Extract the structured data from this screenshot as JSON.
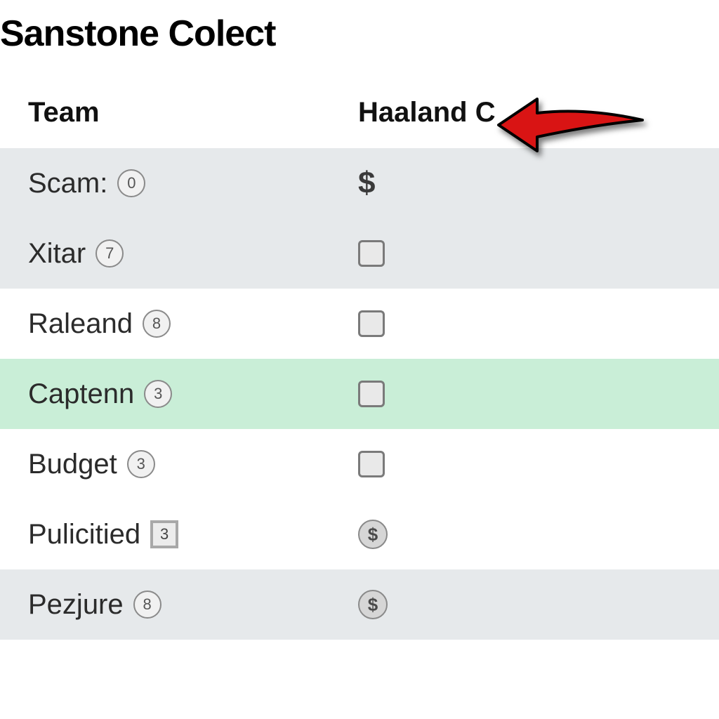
{
  "title": "Sanstone Colect",
  "columns": {
    "team": "Team",
    "haaland": "Haaland C"
  },
  "rows": [
    {
      "label": "Scam",
      "colon": true,
      "badge": "0",
      "badgeShape": "circle",
      "value": {
        "kind": "dollar-text",
        "text": "$"
      },
      "bg": "grey"
    },
    {
      "label": "Xitar",
      "colon": false,
      "badge": "7",
      "badgeShape": "circle",
      "value": {
        "kind": "checkbox"
      },
      "bg": "grey"
    },
    {
      "label": "Raleand",
      "colon": false,
      "badge": "8",
      "badgeShape": "circle",
      "value": {
        "kind": "checkbox"
      },
      "bg": "white"
    },
    {
      "label": "Captenn",
      "colon": false,
      "badge": "3",
      "badgeShape": "circle",
      "value": {
        "kind": "checkbox"
      },
      "bg": "green"
    },
    {
      "label": "Budget",
      "colon": false,
      "badge": "3",
      "badgeShape": "circle",
      "value": {
        "kind": "checkbox"
      },
      "bg": "white"
    },
    {
      "label": "Pulicitied",
      "colon": false,
      "badge": "3",
      "badgeShape": "square",
      "value": {
        "kind": "dollar-badge",
        "text": "$"
      },
      "bg": "white"
    },
    {
      "label": "Pezjure",
      "colon": false,
      "badge": "8",
      "badgeShape": "circle",
      "value": {
        "kind": "dollar-badge",
        "text": "$"
      },
      "bg": "grey"
    }
  ],
  "arrow": {
    "points_to": "column-header-haaland"
  }
}
